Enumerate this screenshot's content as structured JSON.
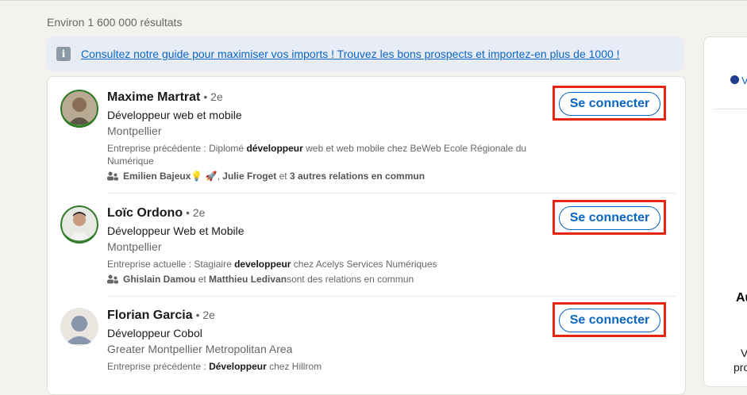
{
  "results_count": "Environ 1 600 000 résultats",
  "banner": {
    "icon": "info-icon",
    "link": "Consultez notre guide pour maximiser vos imports ! Trouvez les bons prospects et importez-en plus de 1000 !"
  },
  "people": [
    {
      "name": "Maxime Martrat",
      "degree": "• 2e",
      "headline": "Développeur web et mobile",
      "location": "Montpellier",
      "summary_prefix": "Entreprise précédente  : Diplomé ",
      "summary_bold": "développeur",
      "summary_suffix": " web et web mobile chez BeWeb Ecole Régionale du Numérique",
      "mutual_a": "Emilien Bajeux",
      "mutual_emoji": " 💡 🚀,",
      "mutual_b": "Julie Froget",
      "mutual_mid": " et ",
      "mutual_c": "3 autres relations en commun",
      "mutual_end": "",
      "button": "Se connecter",
      "avatar": "avatar-photo-open-to-work"
    },
    {
      "name": "Loïc Ordono",
      "degree": "• 2e",
      "headline": "Développeur Web et Mobile",
      "location": "Montpellier",
      "summary_prefix": "Entreprise actuelle  : Stagiaire ",
      "summary_bold": "developpeur",
      "summary_suffix": " chez Acelys Services Numériques",
      "mutual_a": "Ghislain Damou",
      "mutual_emoji": "",
      "mutual_b": "",
      "mutual_mid": " et ",
      "mutual_c": "Matthieu Ledivan",
      "mutual_end": " sont des relations en commun",
      "button": "Se connecter",
      "avatar": "avatar-photo-open-to-work"
    },
    {
      "name": "Florian Garcia",
      "degree": "• 2e",
      "headline": "Développeur Cobol",
      "location": "Greater Montpellier Metropolitan Area",
      "summary_prefix": "Entreprise précédente  : ",
      "summary_bold": "Développeur",
      "summary_suffix": " chez Hillrom",
      "button": "Se connecter",
      "avatar": "avatar-placeholder"
    }
  ],
  "right_panel": {
    "line0": "V",
    "line1": "Au",
    "line2": "V",
    "line3": "pro"
  },
  "colors": {
    "accent": "#0a66c2",
    "highlight_box": "#e8250f",
    "background": "#f4f2ee"
  }
}
